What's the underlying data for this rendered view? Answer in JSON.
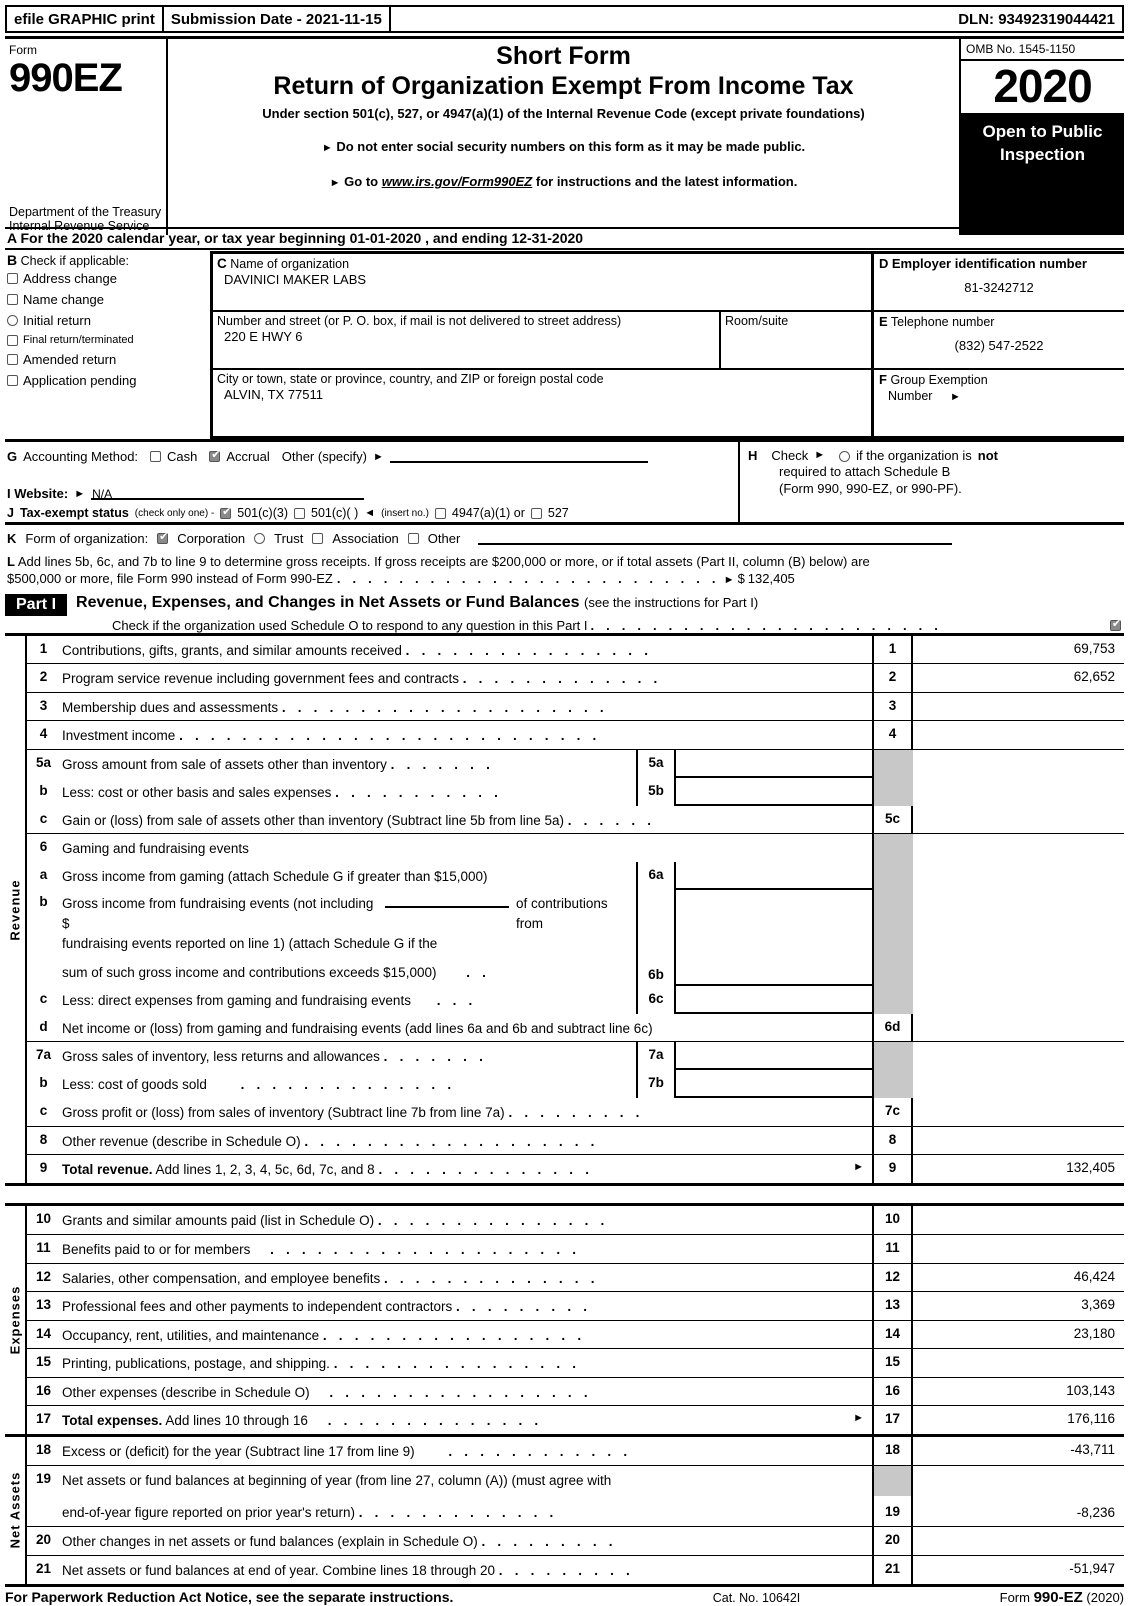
{
  "efile": {
    "graphic_print": "efile GRAPHIC print",
    "submission_date": "Submission Date - 2021-11-15",
    "dln": "DLN: 93492319044421"
  },
  "masthead": {
    "form_label": "Form",
    "form_number": "990EZ",
    "department": "Department of the Treasury Internal Revenue Service",
    "title_line1": "Short Form",
    "title_line2": "Return of Organization Exempt From Income Tax",
    "subtitle": "Under section 501(c), 527, or 4947(a)(1) of the Internal Revenue Code (except private foundations)",
    "bullet1": "Do not enter social security numbers on this form as it may be made public.",
    "bullet2_pre": "Go to",
    "bullet2_link": "www.irs.gov/Form990EZ",
    "bullet2_post": "for instructions and the latest information.",
    "omb": "OMB No. 1545-1150",
    "year": "2020",
    "open_to_public": "Open to Public Inspection"
  },
  "line_a": "A  For the 2020 calendar year, or tax year beginning 01-01-2020 , and ending 12-31-2020",
  "section_b": {
    "letter": "B",
    "heading": "Check if applicable:",
    "items": [
      {
        "label": "Address change",
        "checked": false
      },
      {
        "label": "Name change",
        "checked": false
      },
      {
        "label": "Initial return",
        "checked": false
      },
      {
        "label": "Final return/terminated",
        "checked": false
      },
      {
        "label": "Amended return",
        "checked": false
      },
      {
        "label": "Application pending",
        "checked": false
      }
    ]
  },
  "section_c": {
    "letter": "C",
    "name_label": "Name of organization",
    "name_value": "DAVINICI MAKER LABS",
    "street_label": "Number and street (or P. O. box, if mail is not delivered to street address)",
    "street_value": "220 E HWY 6",
    "room_label": "Room/suite",
    "room_value": "",
    "city_label": "City or town, state or province, country, and ZIP or foreign postal code",
    "city_value": "ALVIN, TX  77511"
  },
  "section_d": {
    "letter": "D",
    "ein_label": "Employer identification number",
    "ein_value": "81-3242712",
    "tel_letter": "E",
    "tel_label": "Telephone number",
    "tel_value": "(832) 547-2522",
    "grp_letter": "F",
    "grp_label_1": "Group Exemption",
    "grp_label_2": "Number",
    "grp_value": ""
  },
  "section_g": {
    "letter": "G",
    "label": "Accounting Method:",
    "cash": "Cash",
    "cash_checked": false,
    "accrual": "Accrual",
    "accrual_checked": true,
    "other": "Other (specify)",
    "other_value": ""
  },
  "section_h": {
    "letter": "H",
    "check_label": "Check",
    "checked": false,
    "text_1": "if the organization is",
    "text_not": "not",
    "text_2": "required to attach Schedule B",
    "text_3": "(Form 990, 990-EZ, or 990-PF)."
  },
  "section_i": {
    "letter": "I",
    "label": "Website:",
    "value": "N/A"
  },
  "section_j": {
    "letter": "J",
    "label": "Tax-exempt status",
    "note": "(check only one) -",
    "options": [
      {
        "label": "501(c)(3)",
        "checked": true
      },
      {
        "label": "501(c)(    )",
        "checked": false
      },
      {
        "label": "4947(a)(1) or",
        "checked": false
      },
      {
        "label": "527",
        "checked": false
      }
    ],
    "insert_no": "(insert no.)"
  },
  "section_k": {
    "letter": "K",
    "label": "Form of organization:",
    "options": [
      {
        "label": "Corporation",
        "checked": true
      },
      {
        "label": "Trust",
        "checked": false
      },
      {
        "label": "Association",
        "checked": false
      },
      {
        "label": "Other",
        "checked": false
      }
    ],
    "other_value": ""
  },
  "section_l": {
    "letter": "L",
    "text_1": "Add lines 5b, 6c, and 7b to line 9 to determine gross receipts. If gross receipts are $200,000 or more, or if total assets (Part II, column (B) below) are",
    "text_2": "$500,000 or more, file Form 990 instead of Form 990-EZ",
    "dots": ". . . . . . . . . . . . . . . . . . . . . . . . .",
    "amount_prefix": "$",
    "amount": "132,405"
  },
  "part_i": {
    "tag": "Part I",
    "title": "Revenue, Expenses, and Changes in Net Assets or Fund Balances",
    "title_note": "(see the instructions for Part I)",
    "schedule_o_text": "Check if the organization used Schedule O to respond to any question in this Part I",
    "schedule_o_dots": ". . . . . . . . . . . . . . . . . . . . . . .",
    "schedule_o_checked": true
  },
  "revenue": {
    "caption": "Revenue",
    "lines": [
      {
        "no": "1",
        "text": "Contributions, gifts, grants, and similar amounts received",
        "dots": ". . . . . . . . . . . . . . . .",
        "box": "1",
        "amount": "69,753"
      },
      {
        "no": "2",
        "text": "Program service revenue including government fees and contracts",
        "dots": ". . . . . . . . . . . . .",
        "box": "2",
        "amount": "62,652"
      },
      {
        "no": "3",
        "text": "Membership dues and assessments",
        "dots": ". . . . . . . . . . . . . . . . . . . . .",
        "box": "3",
        "amount": ""
      },
      {
        "no": "4",
        "text": "Investment income",
        "dots": ". . . . . . . . . . . . . . . . . . . . . . . . . . .",
        "box": "4",
        "amount": ""
      },
      {
        "no": "5a",
        "text": "Gross amount from sale of assets other than inventory",
        "dots": ". . . . . . .",
        "sub_box": "5a",
        "sub_amount": ""
      },
      {
        "no": "b",
        "text": "Less: cost or other basis and sales expenses",
        "dots": ". . . . . . . . . . .",
        "sub_box": "5b",
        "sub_amount": ""
      },
      {
        "no": "c",
        "text": "Gain or (loss) from sale of assets other than inventory (Subtract line 5b from line 5a)",
        "dots": ". . . . . .",
        "box": "5c",
        "amount": ""
      },
      {
        "no": "6",
        "text": "Gaming and fundraising events",
        "dots": "",
        "box": "",
        "amount": ""
      },
      {
        "no": "a",
        "text": "Gross income from gaming (attach Schedule G if greater than $15,000)",
        "dots": "",
        "sub_box": "6a",
        "sub_amount": ""
      },
      {
        "no": "b",
        "text_line1_a": "Gross income from fundraising events (not including $",
        "text_line1_b": "of contributions from",
        "text_line2": "fundraising events reported on line 1) (attach Schedule G if the",
        "text_line3": "sum of such gross income and contributions exceeds $15,000)",
        "dots": ". .",
        "sub_box": "6b",
        "sub_amount": ""
      },
      {
        "no": "c",
        "text": "Less: direct expenses from gaming and fundraising events",
        "dots": ". . .",
        "sub_box": "6c",
        "sub_amount": ""
      },
      {
        "no": "d",
        "text": "Net income or (loss) from gaming and fundraising events (add lines 6a and 6b and subtract line 6c)",
        "dots": "",
        "box": "6d",
        "amount": ""
      },
      {
        "no": "7a",
        "text": "Gross sales of inventory, less returns and allowances",
        "dots": ". . . . . . .",
        "sub_box": "7a",
        "sub_amount": ""
      },
      {
        "no": "b",
        "text": "Less: cost of goods sold",
        "dots": ". . . . . . . . . . . . . .",
        "sub_box": "7b",
        "sub_amount": ""
      },
      {
        "no": "c",
        "text": "Gross profit or (loss) from sales of inventory (Subtract line 7b from line 7a)",
        "dots": ". . . . . . . . .",
        "box": "7c",
        "amount": ""
      },
      {
        "no": "8",
        "text": "Other revenue (describe in Schedule O)",
        "dots": ". . . . . . . . . . . . . . . . . . .",
        "box": "8",
        "amount": ""
      },
      {
        "no": "9",
        "text_bold": "Total revenue.",
        "text": "Add lines 1, 2, 3, 4, 5c, 6d, 7c, and 8",
        "dots": ". . . . . . . . . . . . . .",
        "box": "9",
        "amount": "132,405"
      }
    ]
  },
  "expenses": {
    "caption": "Expenses",
    "lines": [
      {
        "no": "10",
        "text": "Grants and similar amounts paid (list in Schedule O)",
        "dots": ". . . . . . . . . . . . . . .",
        "box": "10",
        "amount": ""
      },
      {
        "no": "11",
        "text": "Benefits paid to or for members",
        "dots": ". . . . . . . . . . . . . . . . . . . .",
        "box": "11",
        "amount": ""
      },
      {
        "no": "12",
        "text": "Salaries, other compensation, and employee benefits",
        "dots": ". . . . . . . . . . . . . .",
        "box": "12",
        "amount": "46,424"
      },
      {
        "no": "13",
        "text": "Professional fees and other payments to independent contractors",
        "dots": ". . . . . . . . .",
        "box": "13",
        "amount": "3,369"
      },
      {
        "no": "14",
        "text": "Occupancy, rent, utilities, and maintenance",
        "dots": ". . . . . . . . . . . . . . . . .",
        "box": "14",
        "amount": "23,180"
      },
      {
        "no": "15",
        "text": "Printing, publications, postage, and shipping.",
        "dots": ". . . . . . . . . . . . . . . .",
        "box": "15",
        "amount": ""
      },
      {
        "no": "16",
        "text": "Other expenses (describe in Schedule O)",
        "dots": ". . . . . . . . . . . . . . . . .",
        "box": "16",
        "amount": "103,143"
      },
      {
        "no": "17",
        "text_bold": "Total expenses.",
        "text": "Add lines 10 through 16",
        "dots": ". . . . . . . . . . . . . .",
        "box": "17",
        "amount": "176,116"
      }
    ]
  },
  "net_assets": {
    "caption": "Net Assets",
    "lines": [
      {
        "no": "18",
        "text": "Excess or (deficit) for the year (Subtract line 17 from line 9)",
        "dots": ". . . . . . . . . . . .",
        "box": "18",
        "amount": "-43,711"
      },
      {
        "no": "19",
        "text_line1": "Net assets or fund balances at beginning of year (from line 27, column (A)) (must agree with",
        "text_line2": "end-of-year figure reported on prior year's return)",
        "dots": ". . . . . . . . . . . . .",
        "box": "19",
        "amount": "-8,236"
      },
      {
        "no": "20",
        "text": "Other changes in net assets or fund balances (explain in Schedule O)",
        "dots": ". . . . . . . . .",
        "box": "20",
        "amount": ""
      },
      {
        "no": "21",
        "text": "Net assets or fund balances at end of year. Combine lines 18 through 20",
        "dots": ". . . . . . . . .",
        "box": "21",
        "amount": "-51,947"
      }
    ]
  },
  "footer": {
    "paperwork": "For Paperwork Reduction Act Notice, see the separate instructions.",
    "cat_no": "Cat. No. 10642I",
    "form_label": "Form",
    "form_number": "990-EZ",
    "form_year": "(2020)"
  }
}
